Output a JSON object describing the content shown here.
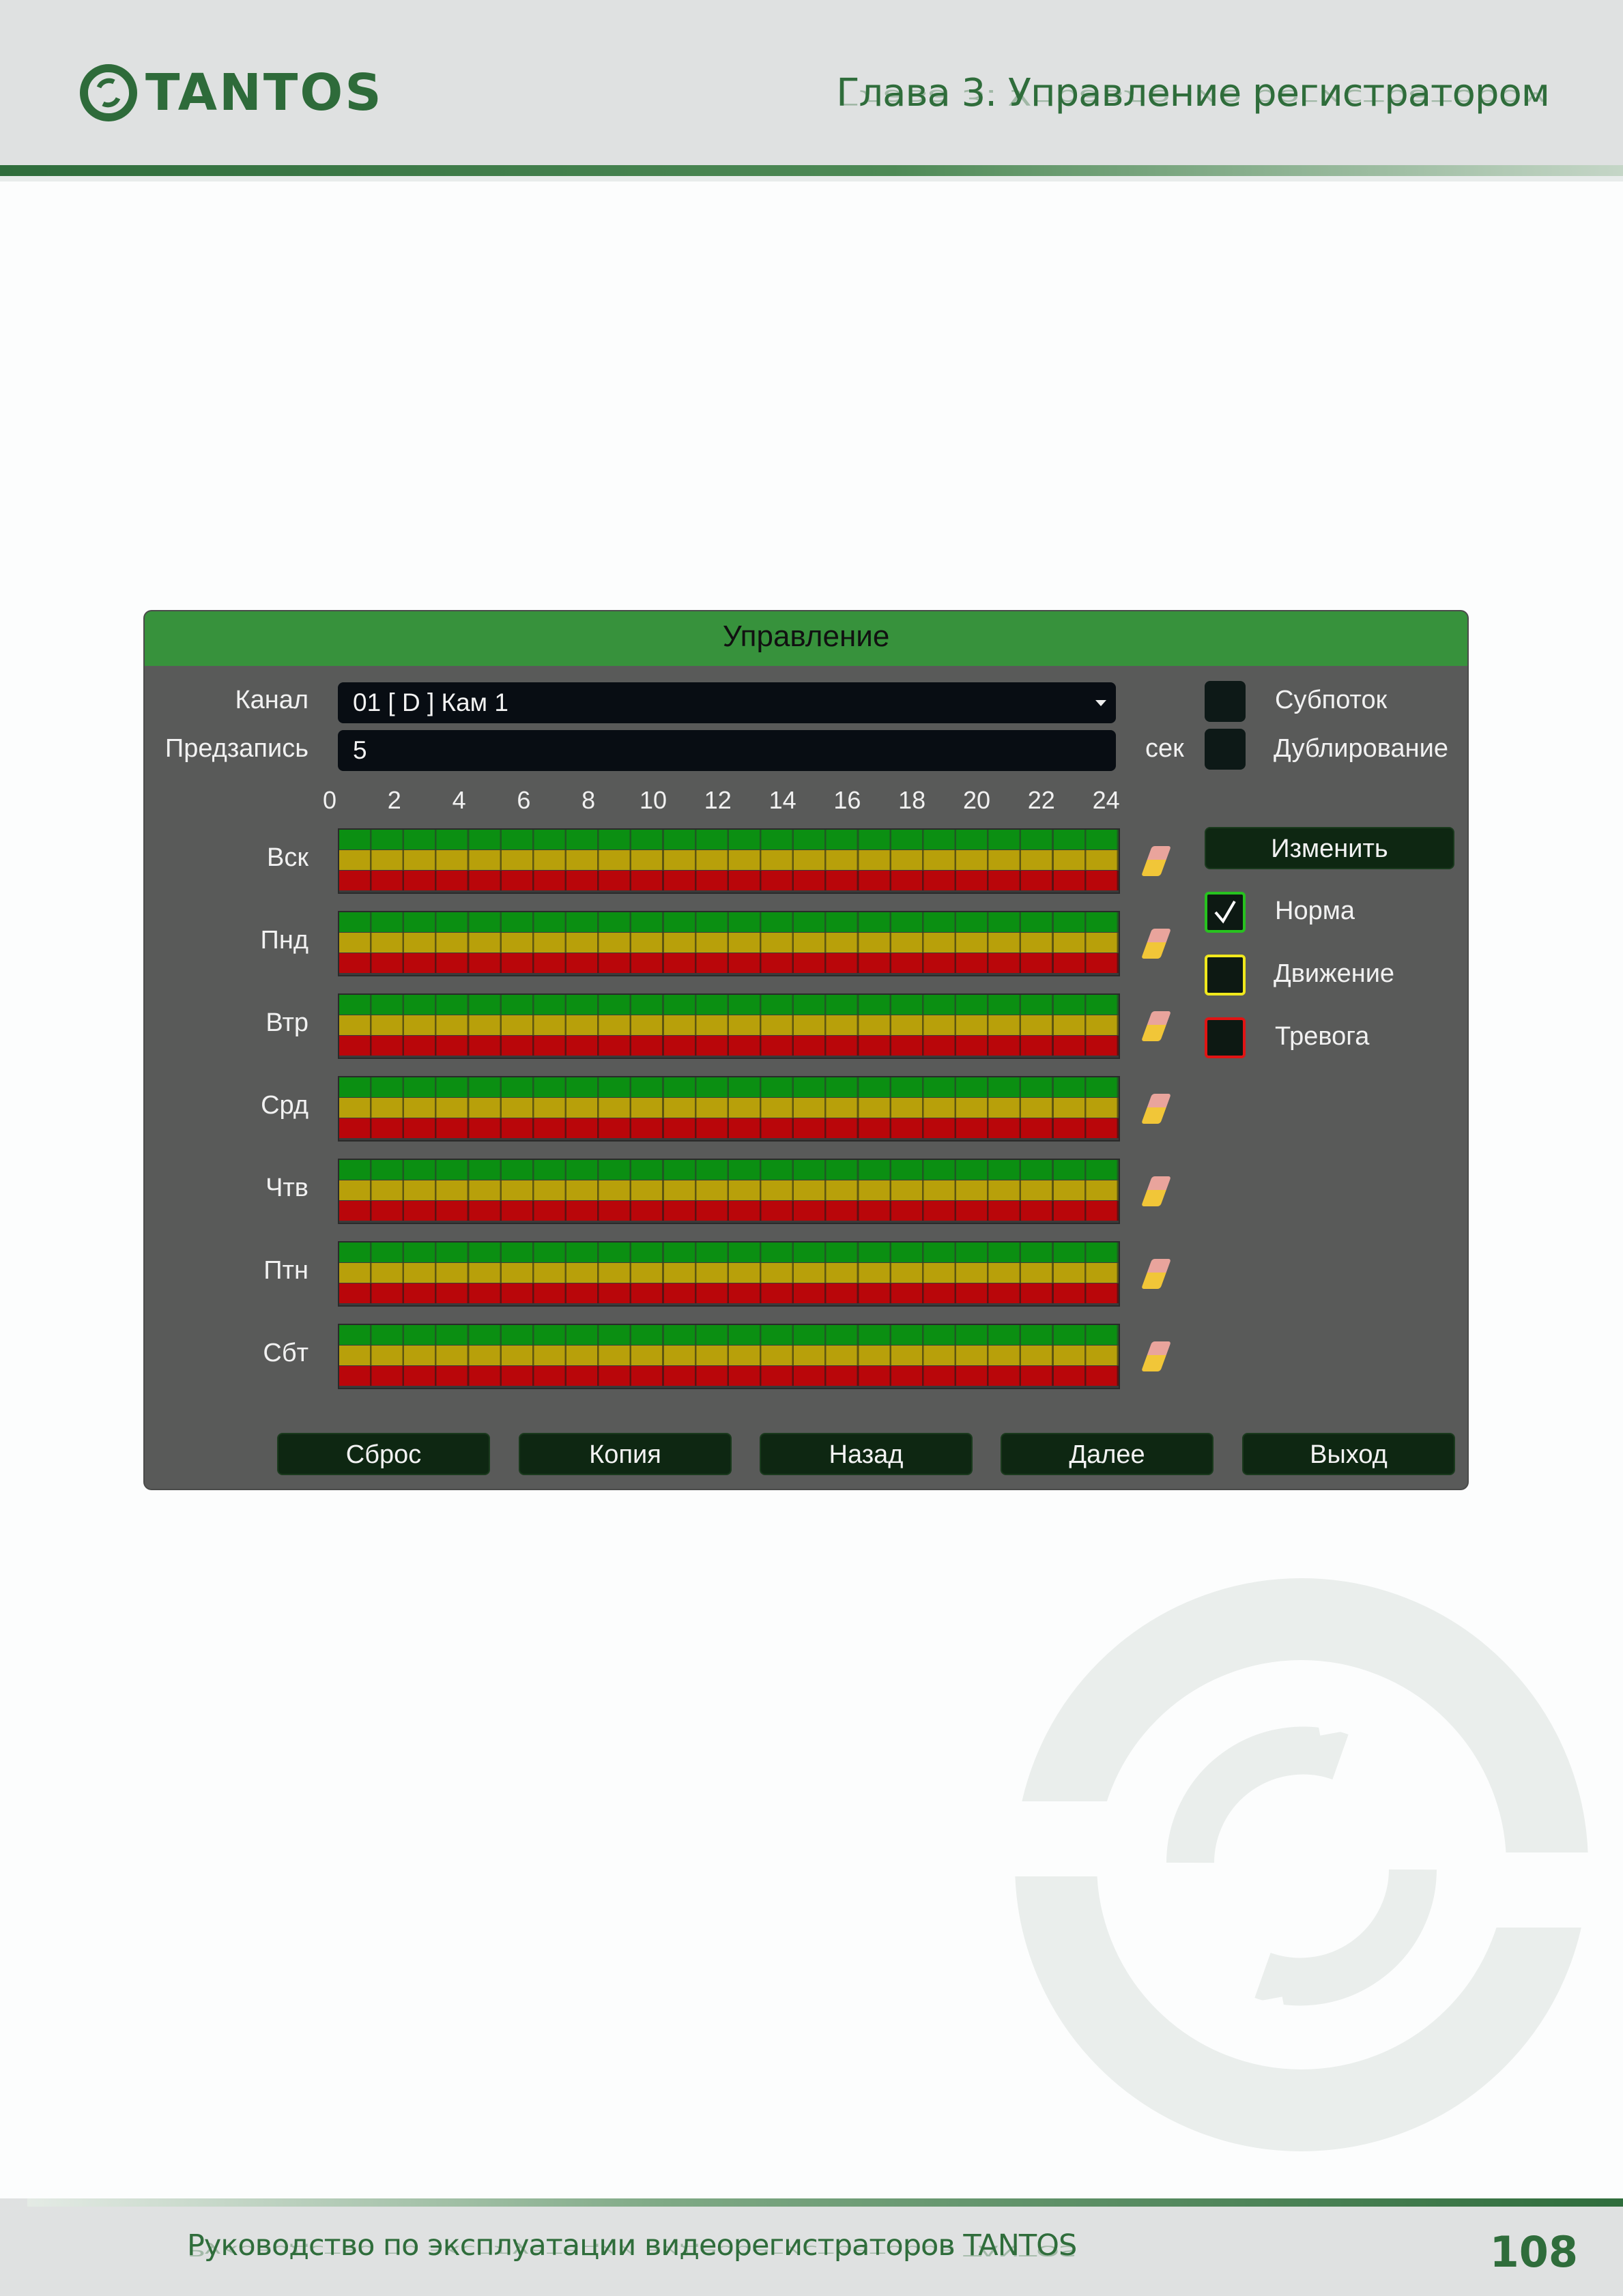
{
  "header": {
    "logo_text": "TANTOS",
    "chapter_title": "Глава 3. Управление регистратором"
  },
  "dialog": {
    "title": "Управление",
    "channel_label": "Канал",
    "channel_value": "01 [ D ] Кам 1",
    "prerecord_label": "Предзапись",
    "prerecord_value": "5",
    "prerecord_unit": "сек",
    "substream_label": "Субпоток",
    "duplication_label": "Дублирование",
    "hour_labels": [
      "0",
      "2",
      "4",
      "6",
      "8",
      "10",
      "12",
      "14",
      "16",
      "18",
      "20",
      "22",
      "24"
    ],
    "days": [
      "Вск",
      "Пнд",
      "Втр",
      "Срд",
      "Чтв",
      "Птн",
      "Сбт"
    ],
    "change_button": "Изменить",
    "legend": [
      {
        "label": "Норма",
        "color": "#27c21f",
        "checked": true
      },
      {
        "label": "Движение",
        "color": "#f0e81d",
        "checked": false
      },
      {
        "label": "Тревога",
        "color": "#e11414",
        "checked": false
      }
    ],
    "buttons": [
      "Сброс",
      "Копия",
      "Назад",
      "Далее",
      "Выход"
    ]
  },
  "footer": {
    "text": "Руководство по эксплуатации видеорегистраторов TANTOS",
    "page_number": "108"
  }
}
